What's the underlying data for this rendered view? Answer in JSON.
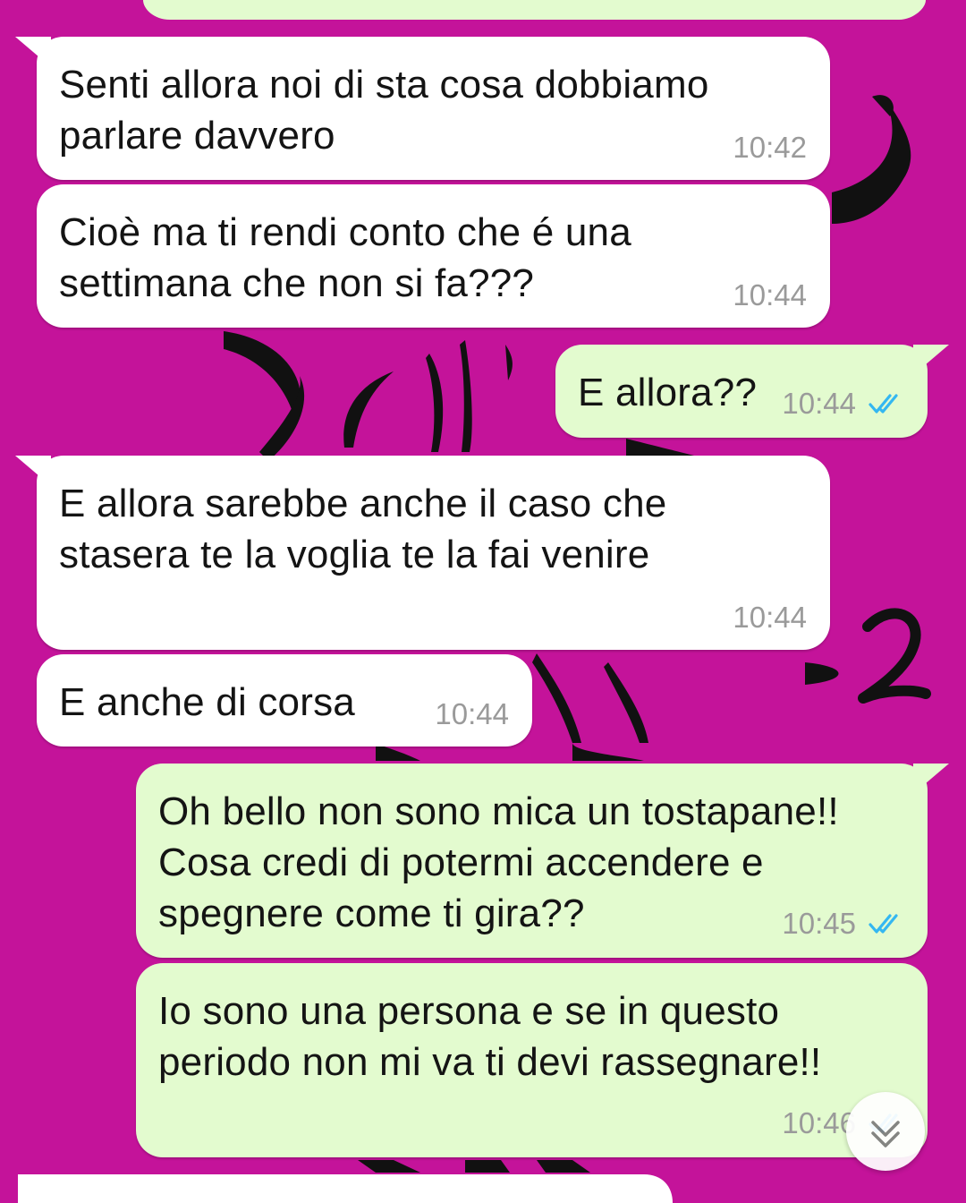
{
  "theme": {
    "wallpaper": "#c4139a",
    "incoming_bubble": "#ffffff",
    "outgoing_bubble": "#e3fbcf",
    "read_tick_color": "#34b7f1",
    "time_color": "#9a9a9a"
  },
  "wallpaper_mark": "2",
  "messages": [
    {
      "direction": "incoming",
      "text": "Senti allora noi di sta cosa dobbiamo\nparlare davvero",
      "time": "10:42"
    },
    {
      "direction": "incoming",
      "text": "Cioè ma ti rendi conto che é una\nsettimana che non si fa???",
      "time": "10:44"
    },
    {
      "direction": "outgoing",
      "text": "E allora??",
      "time": "10:44",
      "status": "read"
    },
    {
      "direction": "incoming",
      "text": "E allora sarebbe anche il caso che\nstasera te la voglia te la fai venire",
      "time": "10:44"
    },
    {
      "direction": "incoming",
      "text": "E anche di corsa",
      "time": "10:44"
    },
    {
      "direction": "outgoing",
      "text": "Oh bello non sono mica un tostapane!!\nCosa credi di potermi accendere e\nspegnere come ti gira??",
      "time": "10:45",
      "status": "read"
    },
    {
      "direction": "outgoing",
      "text": "Io sono una persona e se in questo\nperiodo non mi va  ti devi rassegnare!!",
      "time": "10:46",
      "status": "read"
    }
  ],
  "scroll_button": {
    "icon": "chevron-down-icon"
  }
}
